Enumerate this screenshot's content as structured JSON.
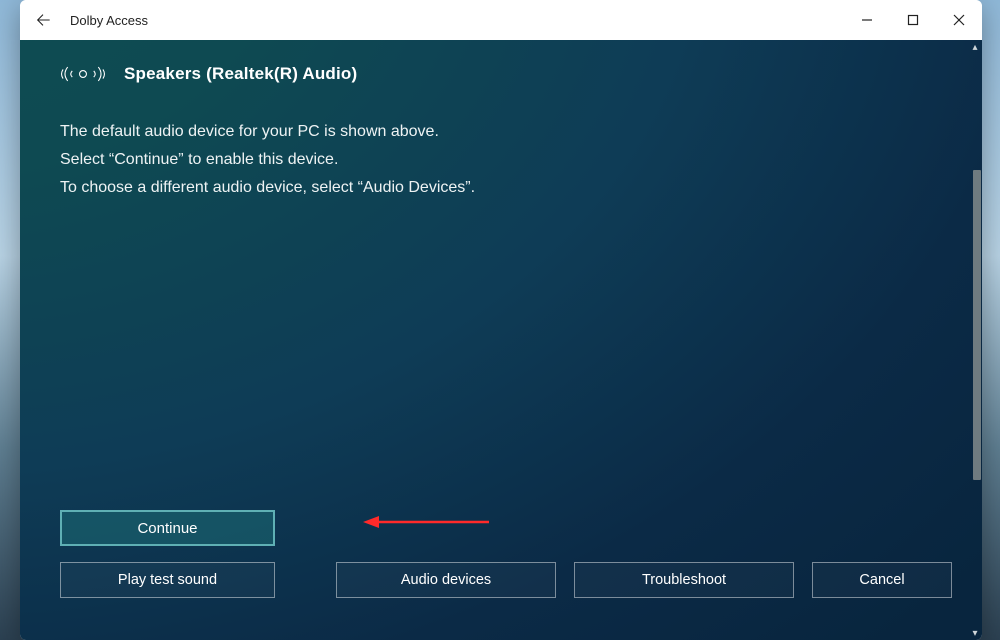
{
  "window": {
    "title": "Dolby Access"
  },
  "device": {
    "name": "Speakers (Realtek(R) Audio)"
  },
  "instructions": {
    "line1": "The default audio device for your PC is shown above.",
    "line2": "Select “Continue” to enable this device.",
    "line3": "To choose a different audio device, select “Audio Devices”."
  },
  "buttons": {
    "continue": "Continue",
    "play_test": "Play test sound",
    "audio_devices": "Audio devices",
    "troubleshoot": "Troubleshoot",
    "cancel": "Cancel"
  }
}
